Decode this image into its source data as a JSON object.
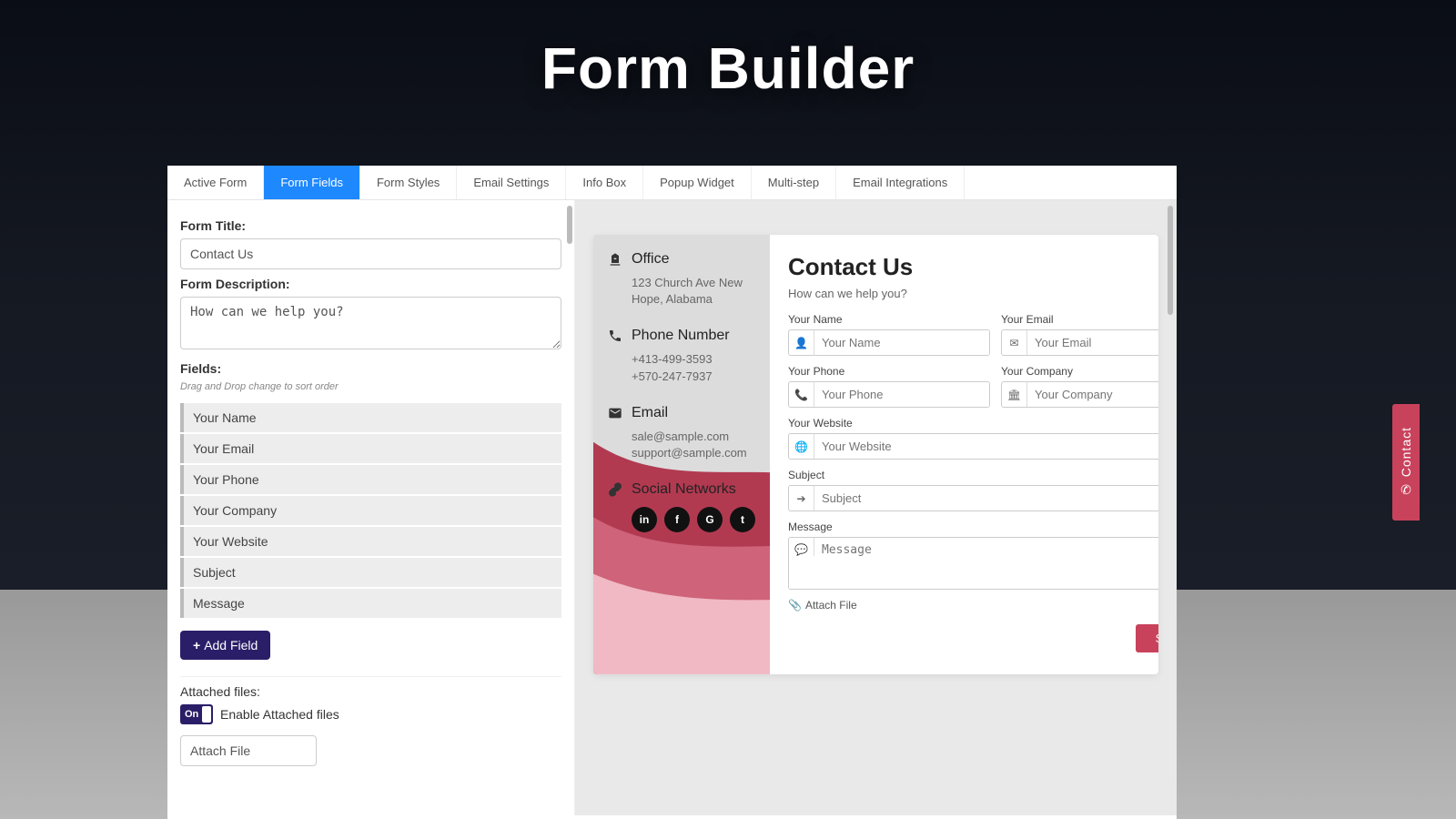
{
  "hero": {
    "title": "Form Builder"
  },
  "tabs": [
    {
      "label": "Active Form",
      "active": false
    },
    {
      "label": "Form Fields",
      "active": true
    },
    {
      "label": "Form Styles",
      "active": false
    },
    {
      "label": "Email Settings",
      "active": false
    },
    {
      "label": "Info Box",
      "active": false
    },
    {
      "label": "Popup Widget",
      "active": false
    },
    {
      "label": "Multi-step",
      "active": false
    },
    {
      "label": "Email Integrations",
      "active": false
    }
  ],
  "editor": {
    "form_title_label": "Form Title:",
    "form_title_value": "Contact Us",
    "form_description_label": "Form Description:",
    "form_description_value": "How can we help you?",
    "fields_label": "Fields:",
    "fields_helper": "Drag and Drop change to sort order",
    "fields": [
      "Your Name",
      "Your Email",
      "Your Phone",
      "Your Company",
      "Your Website",
      "Subject",
      "Message"
    ],
    "add_field_label": "Add Field",
    "attached_files_label": "Attached files:",
    "toggle_state": "On",
    "toggle_caption": "Enable Attached files",
    "attach_file_placeholder": "Attach File"
  },
  "preview": {
    "info": {
      "office_heading": "Office",
      "office_address": "123 Church Ave New Hope, Alabama",
      "phone_heading": "Phone Number",
      "phone1": "+413-499-3593",
      "phone2": "+570-247-7937",
      "email_heading": "Email",
      "email1": "sale@sample.com",
      "email2": "support@sample.com",
      "social_heading": "Social Networks",
      "socials": [
        "in",
        "f",
        "G",
        "t"
      ]
    },
    "form": {
      "title": "Contact Us",
      "description": "How can we help you?",
      "name_label": "Your Name",
      "name_placeholder": "Your Name",
      "email_label": "Your Email",
      "email_placeholder": "Your Email",
      "phone_label": "Your Phone",
      "phone_placeholder": "Your Phone",
      "company_label": "Your Company",
      "company_placeholder": "Your Company",
      "website_label": "Your Website",
      "website_placeholder": "Your Website",
      "subject_label": "Subject",
      "subject_placeholder": "Subject",
      "message_label": "Message",
      "message_placeholder": "Message",
      "attach_file": "Attach File",
      "send_label": "Send"
    }
  },
  "contact_tab": {
    "label": "Contact"
  }
}
